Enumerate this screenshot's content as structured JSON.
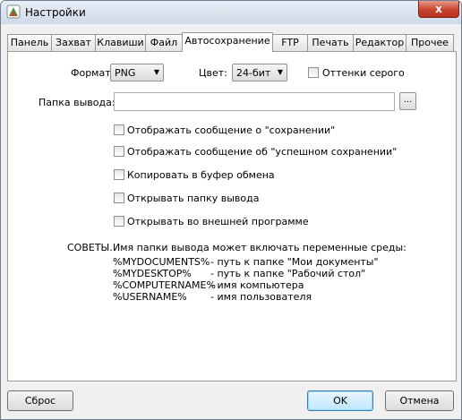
{
  "window": {
    "title": "Настройки",
    "close_glyph": "x"
  },
  "tabs": [
    "Панель",
    "Захват",
    "Клавиши",
    "Файл",
    "Автосохранение",
    "FTP",
    "Печать",
    "Редактор",
    "Прочее"
  ],
  "active_tab": "Автосохранение",
  "format": {
    "label": "Формат:",
    "value": "PNG"
  },
  "color": {
    "label": "Цвет:",
    "value": "24-бит"
  },
  "grayscale": {
    "label": "Оттенки серого",
    "checked": false
  },
  "output_folder": {
    "label": "Папка вывода:",
    "value": "",
    "browse_label": "..."
  },
  "options": [
    {
      "label": "Отображать сообщение о \"сохранении\"",
      "checked": false
    },
    {
      "label": "Отображать сообщение об \"успешном сохранении\"",
      "checked": false
    },
    {
      "label": "Копировать в буфер обмена",
      "checked": false
    },
    {
      "label": "Открывать папку вывода",
      "checked": false
    },
    {
      "label": "Открывать во внешней программе",
      "checked": false
    }
  ],
  "tips": {
    "heading": "СОВЕТЫ.",
    "intro": "Имя папки вывода может включать переменные среды:",
    "vars": [
      {
        "name": "%MYDOCUMENTS%",
        "desc": "- путь к папке \"Мои документы\""
      },
      {
        "name": "%MYDESKTOP%",
        "desc": "- путь к папке \"Рабочий стол\""
      },
      {
        "name": "%COMPUTERNAME%",
        "desc": "- имя компьютера"
      },
      {
        "name": "%USERNAME%",
        "desc": "- имя пользователя"
      }
    ]
  },
  "buttons": {
    "reset": "Сброс",
    "ok": "OK",
    "cancel": "Отмена"
  }
}
